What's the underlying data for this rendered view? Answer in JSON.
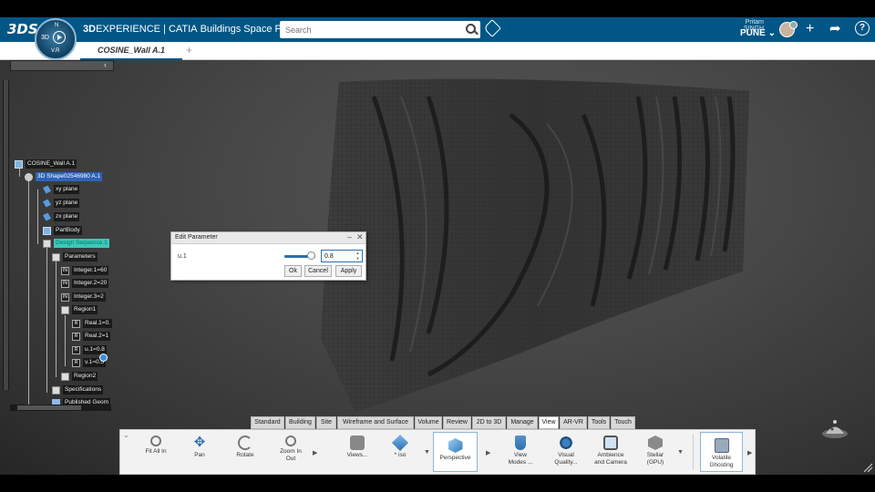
{
  "app": {
    "brand_strong": "3D",
    "brand_rest": "EXPERIENCE | CATIA",
    "app_name": "Buildings Space Planning",
    "compass": {
      "top": "N",
      "left": "3D",
      "version": "V.R"
    }
  },
  "search": {
    "placeholder": "Search"
  },
  "user": {
    "name": "Pritam SINGH",
    "location": "PUNE"
  },
  "header_icons": [
    "3ds-logo-icon",
    "tag-icon",
    "avatar",
    "add-icon",
    "share-icon",
    "help-icon"
  ],
  "tab": {
    "title": "COSINE_Wall A.1",
    "add": "+"
  },
  "tree": {
    "collapse": "‹",
    "nodes": [
      {
        "label": "COSINE_Wall A.1",
        "icon": "product-icon",
        "state": "normal"
      },
      {
        "label": "3D Shape02546980 A.1",
        "icon": "part-icon",
        "state": "selected"
      },
      {
        "label": "xy plane",
        "icon": "plane-icon",
        "state": "normal"
      },
      {
        "label": "yz plane",
        "icon": "plane-icon",
        "state": "normal"
      },
      {
        "label": "zx plane",
        "icon": "plane-icon",
        "state": "normal"
      },
      {
        "label": "PartBody",
        "icon": "body-icon",
        "state": "normal"
      },
      {
        "label": "Design Sequence.1",
        "icon": "sequence-icon",
        "state": "highlighted"
      },
      {
        "label": "Parameters",
        "icon": "parameters-icon",
        "state": "normal"
      },
      {
        "label": "Integer.1=60",
        "icon": "int-param-icon",
        "state": "normal"
      },
      {
        "label": "Integer.2=20",
        "icon": "int-param-icon",
        "state": "normal"
      },
      {
        "label": "Integer.3=2",
        "icon": "int-param-icon",
        "state": "normal"
      },
      {
        "label": "Region1",
        "icon": "region-icon",
        "state": "normal"
      },
      {
        "label": "Real.1=0.",
        "icon": "real-param-icon",
        "state": "normal"
      },
      {
        "label": "Real.2=1",
        "icon": "real-param-icon",
        "state": "normal"
      },
      {
        "label": "u.1=0.8",
        "icon": "real-param-icon",
        "state": "normal"
      },
      {
        "label": "v.1=0.5",
        "icon": "real-param-icon",
        "state": "normal"
      },
      {
        "label": "Region2",
        "icon": "region-icon",
        "state": "normal"
      },
      {
        "label": "Specifications",
        "icon": "specifications-icon",
        "state": "normal"
      },
      {
        "label": "Published Geom",
        "icon": "geometry-icon",
        "state": "normal"
      }
    ]
  },
  "dialog": {
    "title": "Edit Parameter",
    "minimize": "–",
    "close": "✕",
    "param_name": "u.1",
    "value": "0.8",
    "slider_fraction": 0.8,
    "ok": "Ok",
    "cancel": "Cancel",
    "apply": "Apply"
  },
  "ribbon": {
    "tabs": [
      "Standard",
      "Building",
      "Site",
      "Wireframe and Surface",
      "Volume",
      "Review",
      "2D to 3D",
      "Manage",
      "View",
      "AR-VR",
      "Tools",
      "Touch"
    ],
    "active_tab": "View",
    "commands": [
      {
        "label": "Fit All In",
        "icon": "fit-all-icon"
      },
      {
        "label": "Pan",
        "icon": "pan-icon"
      },
      {
        "label": "Rotate",
        "icon": "rotate-icon"
      },
      {
        "label": "Zoom In Out",
        "icon": "zoom-icon"
      },
      {
        "label": "Views...",
        "icon": "views-icon"
      },
      {
        "label": "* iso",
        "icon": "iso-icon"
      },
      {
        "label": "Perspective",
        "icon": "perspective-icon"
      },
      {
        "label": "View Modes ...",
        "icon": "view-modes-icon"
      },
      {
        "label": "Visual Quality...",
        "icon": "visual-quality-icon"
      },
      {
        "label": "Ambience and Camera",
        "icon": "ambience-camera-icon"
      },
      {
        "label": "Stellar (GPU)",
        "icon": "stellar-icon"
      },
      {
        "label": "Volatile Ghosting",
        "icon": "volatile-ghosting-icon"
      }
    ]
  }
}
